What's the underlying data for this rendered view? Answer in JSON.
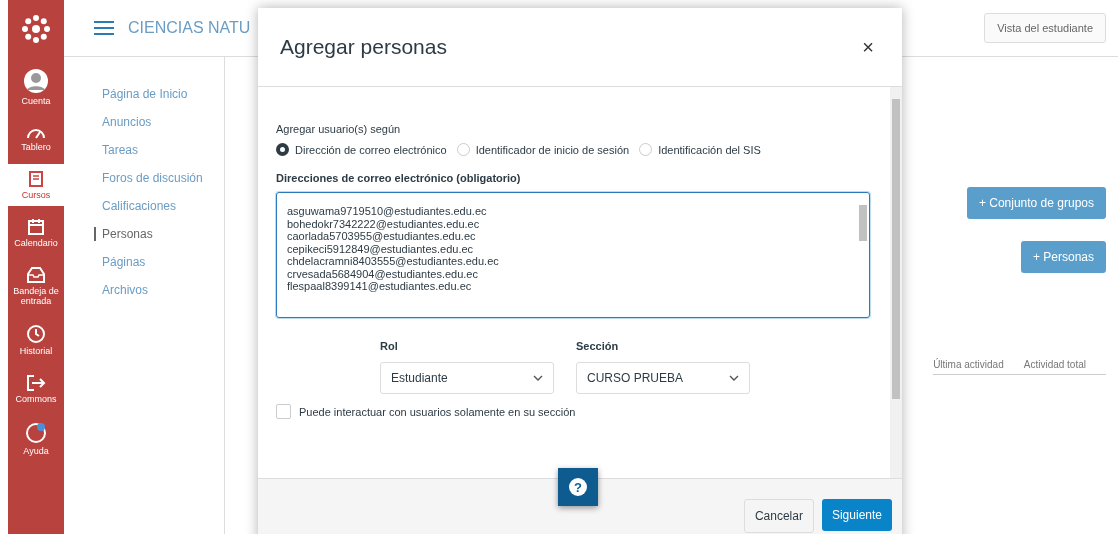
{
  "global_nav": [
    {
      "label": "Cuenta",
      "kind": "avatar",
      "selected": false
    },
    {
      "label": "Tablero",
      "kind": "dashboard",
      "selected": false
    },
    {
      "label": "Cursos",
      "kind": "book",
      "selected": true
    },
    {
      "label": "Calendario",
      "kind": "calendar",
      "selected": false
    },
    {
      "label": "Bandeja de entrada",
      "kind": "inbox",
      "selected": false
    },
    {
      "label": "Historial",
      "kind": "clock",
      "selected": false
    },
    {
      "label": "Commons",
      "kind": "commons",
      "selected": false
    },
    {
      "label": "Ayuda",
      "kind": "help",
      "selected": false
    }
  ],
  "course_header": {
    "title": "CIENCIAS NATU"
  },
  "course_nav": [
    {
      "label": "Página de Inicio",
      "selected": false
    },
    {
      "label": "Anuncios",
      "selected": false
    },
    {
      "label": "Tareas",
      "selected": false
    },
    {
      "label": "Foros de discusión",
      "selected": false
    },
    {
      "label": "Calificaciones",
      "selected": false
    },
    {
      "label": "Personas",
      "selected": true
    },
    {
      "label": "Páginas",
      "selected": false
    },
    {
      "label": "Archivos",
      "selected": false
    }
  ],
  "page_actions": {
    "student_view": "Vista del estudiante",
    "group_set_button": "+ Conjunto de grupos",
    "people_button": "+ Personas"
  },
  "table": {
    "columns": [
      "Última actividad",
      "Actividad total"
    ]
  },
  "dialog": {
    "title": "Agregar personas",
    "close": "×",
    "add_by_label": "Agregar usuario(s) según",
    "add_by_options": [
      {
        "label": "Dirección de correo electrónico",
        "selected": true
      },
      {
        "label": "Identificador de inicio de sesión",
        "selected": false
      },
      {
        "label": "Identificación del SIS",
        "selected": false
      }
    ],
    "emails_label": "Direcciones de correo electrónico (obligatorio)",
    "emails": [
      "asguwama9719510@estudiantes.edu.ec",
      "bohedokr7342222@estudiantes.edu.ec",
      "caorlada5703955@estudiantes.edu.ec",
      "cepikeci5912849@estudiantes.edu.ec",
      "chdelacramni8403555@estudiantes.edu.ec",
      "crvesada5684904@estudiantes.edu.ec",
      "flespaal8399141@estudiantes.edu.ec"
    ],
    "role": {
      "label": "Rol",
      "value": "Estudiante"
    },
    "section": {
      "label": "Sección",
      "value": "CURSO PRUEBA"
    },
    "limit_checkbox": {
      "label": "Puede interactuar con usuarios solamente en su sección",
      "checked": false
    },
    "help_button": "?",
    "cancel": "Cancelar",
    "next": "Siguiente"
  }
}
